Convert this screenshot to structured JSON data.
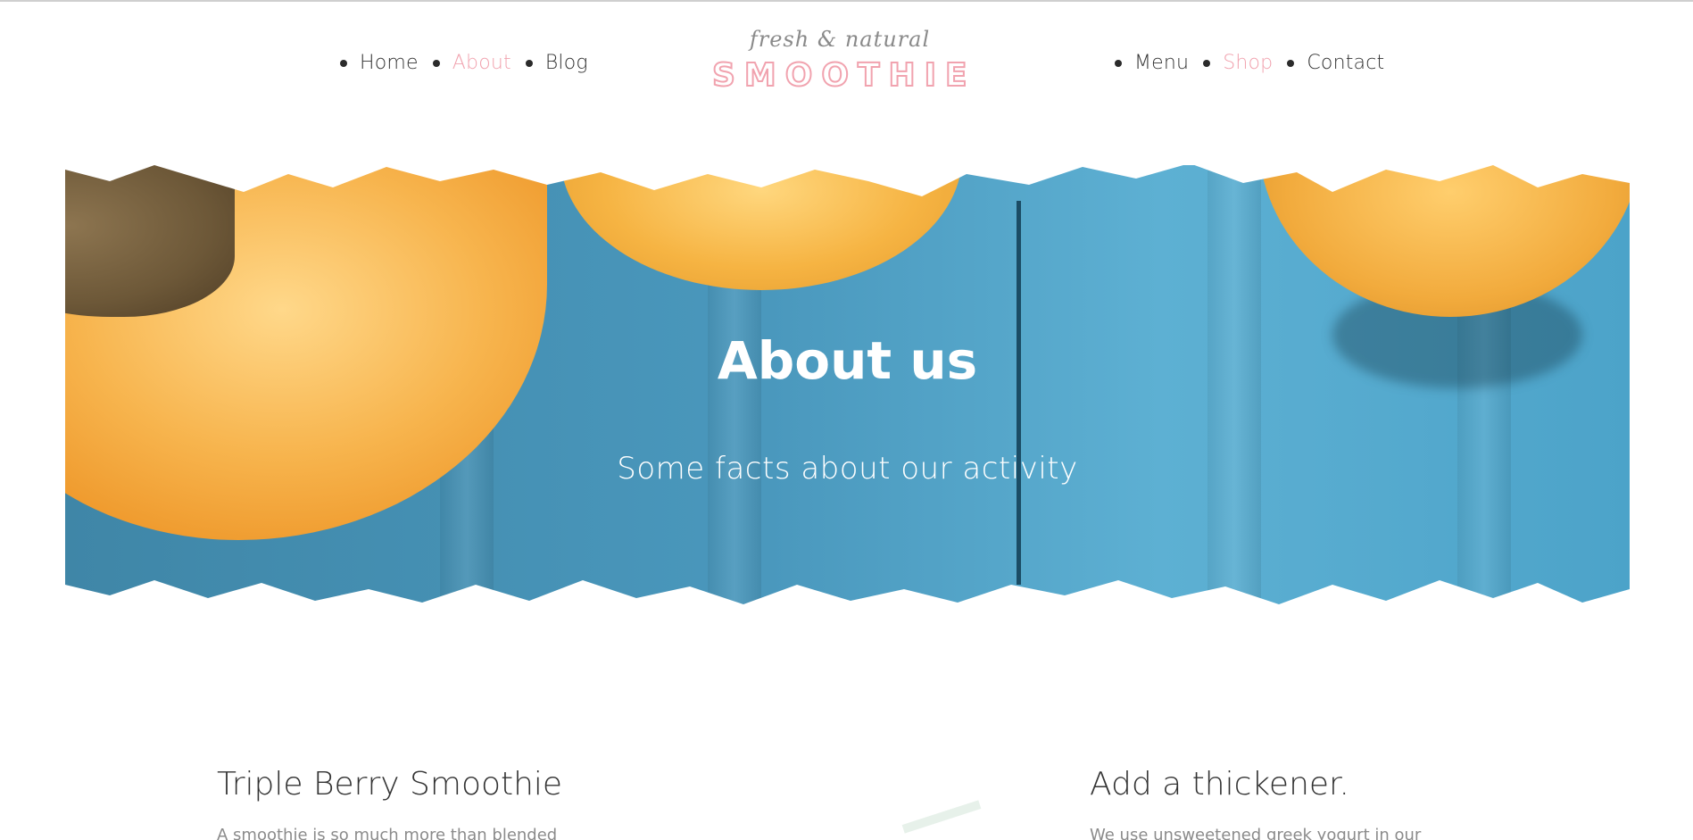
{
  "colors": {
    "accent": "#f1a3af",
    "text": "#333333",
    "muted": "#8b8b8b"
  },
  "nav": {
    "left": [
      {
        "label": "Home",
        "active": false
      },
      {
        "label": "About",
        "active": true
      },
      {
        "label": "Blog",
        "active": false
      }
    ],
    "right": [
      {
        "label": "Menu",
        "active": false
      },
      {
        "label": "Shop",
        "active": true
      },
      {
        "label": "Contact",
        "active": false
      }
    ]
  },
  "logo": {
    "tagline": "fresh & natural",
    "name": "SMOOTHIE"
  },
  "hero": {
    "title": "About us",
    "subtitle": "Some facts about our activity"
  },
  "content": {
    "left": {
      "title": "Triple Berry Smoothie",
      "text": "A smoothie is so much more than blended"
    },
    "right": {
      "title": "Add a thickener.",
      "text": "We use unsweetened greek yogurt in our"
    }
  }
}
